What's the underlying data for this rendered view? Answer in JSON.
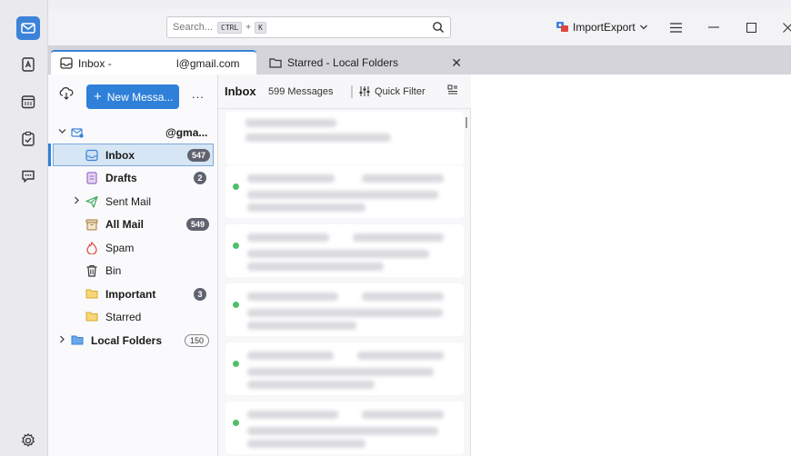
{
  "search": {
    "placeholder": "Search...",
    "shortcut_key1": "CTRL",
    "shortcut_plus": "+",
    "shortcut_key2": "K"
  },
  "addon": {
    "label": "ImportExport"
  },
  "tabs": [
    {
      "label": "Inbox - ",
      "account": "l@gmail.com",
      "icon": "inbox-icon"
    },
    {
      "label": "Starred - Local Folders",
      "icon": "folder-icon"
    }
  ],
  "toolbar": {
    "new_message": "New Messa...",
    "more": "..."
  },
  "account": {
    "name": "@gma..."
  },
  "folders": [
    {
      "label": "Inbox",
      "count": "547",
      "bold": true,
      "icon": "inbox-icon"
    },
    {
      "label": "Drafts",
      "count": "2",
      "bold": true,
      "icon": "drafts-icon"
    },
    {
      "label": "Sent Mail",
      "count": "",
      "bold": false,
      "icon": "sent-icon"
    },
    {
      "label": "All Mail",
      "count": "549",
      "bold": true,
      "icon": "archive-icon"
    },
    {
      "label": "Spam",
      "count": "",
      "bold": false,
      "icon": "spam-icon"
    },
    {
      "label": "Bin",
      "count": "",
      "bold": false,
      "icon": "trash-icon"
    },
    {
      "label": "Important",
      "count": "3",
      "bold": true,
      "icon": "folder-icon"
    },
    {
      "label": "Starred",
      "count": "",
      "bold": false,
      "icon": "folder-icon"
    }
  ],
  "local_folders": {
    "label": "Local Folders",
    "count": "150"
  },
  "thread_header": {
    "folder": "Inbox",
    "count": "599 Messages",
    "quick_filter": "Quick Filter"
  },
  "colors": {
    "accent": "#2f80d8",
    "unread_dot": "#4fbf6a",
    "badge": "#5f6370"
  }
}
